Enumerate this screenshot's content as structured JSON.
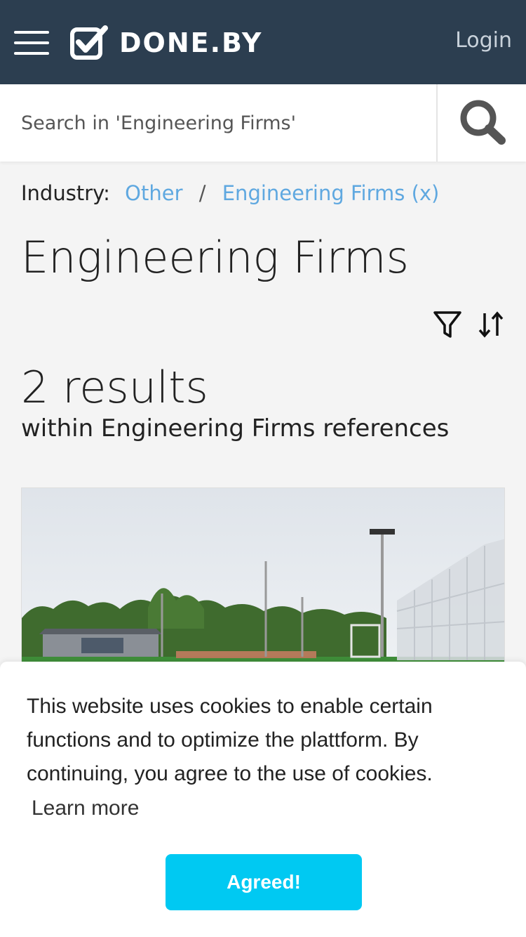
{
  "header": {
    "brand": "DONE.BY",
    "login_label": "Login",
    "menu_icon": "hamburger-icon",
    "logo_icon": "checkbox-check-icon"
  },
  "search": {
    "placeholder": "Search in 'Engineering Firms'",
    "icon": "search-icon"
  },
  "breadcrumb": {
    "label": "Industry:",
    "items": [
      "Other",
      "Engineering Firms (x)"
    ],
    "separator": "/"
  },
  "page": {
    "title": "Engineering Firms",
    "filter_icon": "filter-icon",
    "sort_icon": "sort-icon"
  },
  "results": {
    "count": "2 results",
    "subtitle": "within Engineering Firms references"
  },
  "cookie_banner": {
    "text": "This website uses cookies to enable certain functions and to optimize the plattform. By continuing, you agree to the use of cookies.",
    "learn_more": "Learn more",
    "agree_label": "Agreed!"
  },
  "colors": {
    "header_bg": "#2c3e50",
    "link": "#5fa8e0",
    "accent": "#00c9f2"
  }
}
